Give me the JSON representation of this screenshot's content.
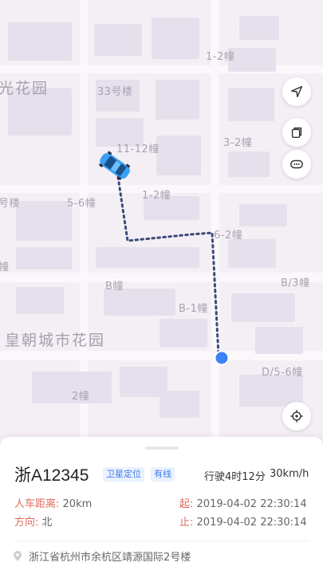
{
  "map": {
    "labels": {
      "park_left": "光花园",
      "b33": "33号楼",
      "b1_2_top": "1-2幢",
      "b11_12": "11-12幢",
      "b3_2": "3-2幢",
      "b1_2_mid": "1-2幢",
      "b5_6": "5-6幢",
      "b_left_edge": "号楼",
      "b6_2": "6-2幢",
      "b_left_small": "幢",
      "b_b": "B幢",
      "b_b3": "B/3幢",
      "b_b1": "B-1幢",
      "huangchao": "皇朝城市花园",
      "b_d56": "D/5-6幢",
      "b2": "2幢"
    },
    "buttons": {
      "navigate": "navigation-arrow",
      "copy": "copy",
      "more": "more-dots",
      "locate": "locate-crosshair"
    }
  },
  "vehicle": {
    "plate": "浙A12345",
    "tags": [
      "卫星定位",
      "有线"
    ],
    "drive_time": "行驶4时12分",
    "speed": "30km/h",
    "person_distance_label": "人车距离:",
    "person_distance_value": "20km",
    "direction_label": "方向:",
    "direction_value": "北",
    "start_label": "起:",
    "start_time": "2019-04-02   22:30:14",
    "end_label": "止:",
    "end_time": "2019-04-02   22:30:14",
    "address": "浙江省杭州市余杭区靖源国际2号楼"
  },
  "colors": {
    "accent": "#3d7cf0",
    "label_red": "#e06a5b",
    "car": "#3aa0f5",
    "marker": "#3b82f6",
    "route": "#3b4a78"
  }
}
